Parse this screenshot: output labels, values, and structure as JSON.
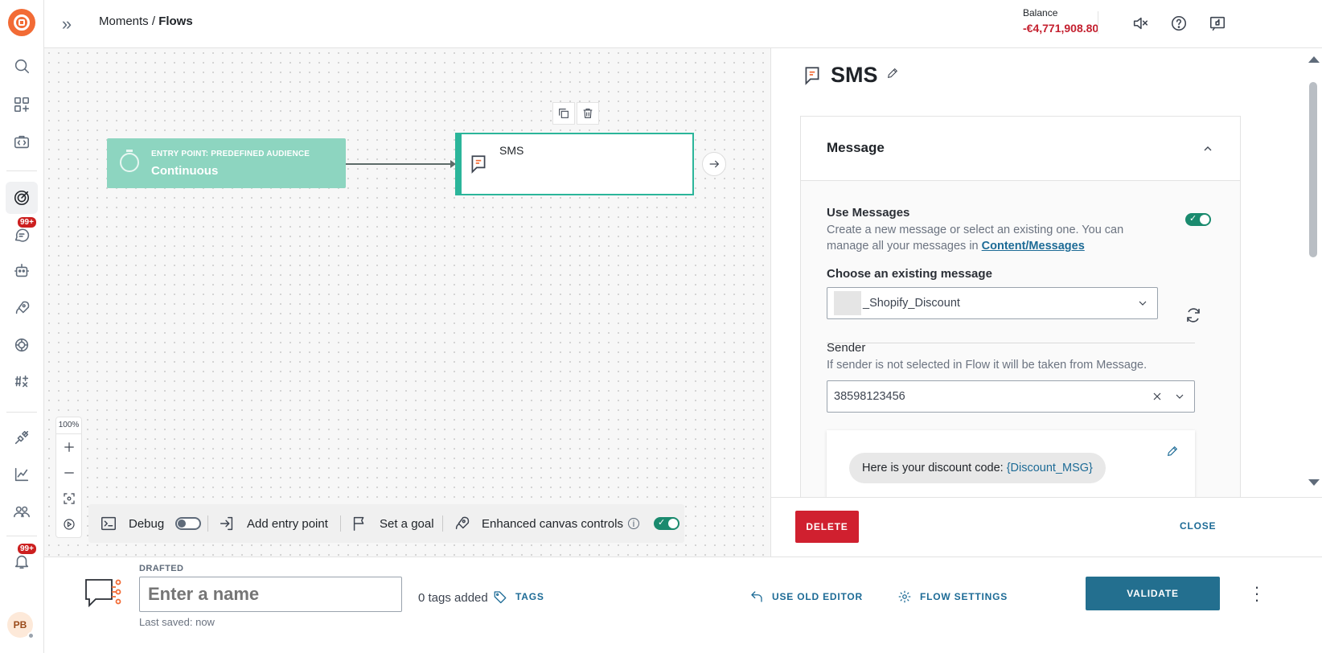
{
  "breadcrumb": {
    "parent": "Moments / ",
    "current": "Flows"
  },
  "balance": {
    "label": "Balance",
    "value": "-€4,771,908.80"
  },
  "rail": {
    "badges": {
      "conversations": "99+",
      "notifications": "99+"
    },
    "avatar_initials": "PB"
  },
  "canvas": {
    "entry_node": {
      "type_label": "ENTRY POINT: PREDEFINED AUDIENCE",
      "title": "Continuous"
    },
    "sms_node": {
      "title": "SMS"
    },
    "zoom_level": "100%",
    "toolbar": {
      "debug_label": "Debug",
      "debug_enabled": false,
      "add_entry_label": "Add entry point",
      "goal_label": "Set a goal",
      "enhanced_label": "Enhanced canvas controls",
      "enhanced_enabled": true
    }
  },
  "panel": {
    "title": "SMS",
    "section_title": "Message",
    "use_messages": {
      "label": "Use Messages",
      "enabled": true,
      "desc_prefix": "Create a new message or select an existing one. You can manage all your messages in ",
      "link": "Content/Messages"
    },
    "choose_label": "Choose an existing message",
    "selected_message": "_Shopify_Discount",
    "sender": {
      "label": "Sender",
      "desc": "If sender is not selected in Flow it will be taken from Message.",
      "value": "38598123456"
    },
    "preview": {
      "text": "Here is your discount code:",
      "variable": "{Discount_MSG}"
    },
    "delete_label": "DELETE",
    "close_label": "CLOSE"
  },
  "footer": {
    "status": "DRAFTED",
    "name_placeholder": "Enter a name",
    "last_saved": "Last saved: now",
    "tags_count": "0 tags added",
    "tags_label": "TAGS",
    "old_editor_label": "USE OLD EDITOR",
    "flow_settings_label": "FLOW SETTINGS",
    "validate_label": "VALIDATE"
  },
  "colors": {
    "accent": "#236f8f",
    "danger": "#d0202f",
    "node_green": "#2bb59a",
    "entry_green": "#8dd5c0",
    "brand": "#f26b35"
  }
}
